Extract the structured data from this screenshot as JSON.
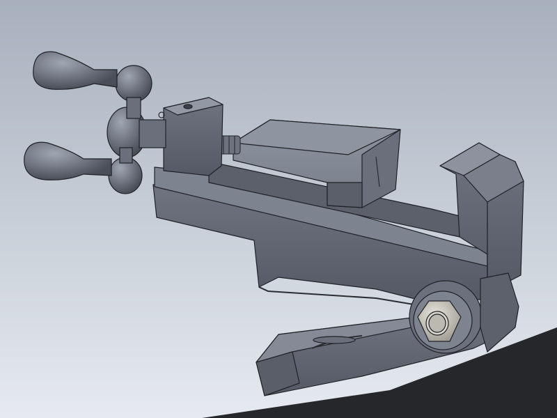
{
  "scene": {
    "subject": "tilting-machine-vise-3d-model",
    "colors": {
      "background_top": "#a7b0bd",
      "background_bottom": "#e6eaf0",
      "metal_light": "#8a8f9b",
      "metal_mid": "#6b707c",
      "metal_dark": "#4b4f5a",
      "edge": "#1f2126",
      "shadow": "#1b1c20",
      "fastener": "#c9c6bd"
    },
    "icons": [
      "handwheel-handle-icon",
      "hex-nut-icon",
      "lead-screw-icon"
    ]
  }
}
